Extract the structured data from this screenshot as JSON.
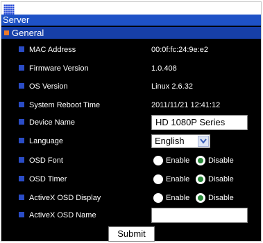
{
  "panel": {
    "title": "Server",
    "section": "General"
  },
  "fields": {
    "mac_address": {
      "label": "MAC Address",
      "value": "00:0f:fc:24:9e:e2"
    },
    "firmware_version": {
      "label": "Firmware Version",
      "value": "1.0.408"
    },
    "os_version": {
      "label": "OS Version",
      "value": "Linux 2.6.32"
    },
    "reboot_time": {
      "label": "System Reboot Time",
      "value": "2011/11/21 12:41:12"
    },
    "device_name": {
      "label": "Device Name",
      "value": "HD 1080P Series"
    },
    "language": {
      "label": "Language",
      "selected": "English"
    },
    "osd_font": {
      "label": "OSD Font",
      "selected": "Disable"
    },
    "osd_timer": {
      "label": "OSD Timer",
      "selected": "Disable"
    },
    "activex_osd_display": {
      "label": "ActiveX OSD Display",
      "selected": "Disable"
    },
    "activex_osd_name": {
      "label": "ActiveX OSD Name",
      "value": ""
    }
  },
  "radio_options": {
    "enable": "Enable",
    "disable": "Disable"
  },
  "submit_label": "Submit",
  "colors": {
    "background": "#000000",
    "title_band": "#1e52c6",
    "section_bar": "#163fa8",
    "section_square": "#f07a2a",
    "bullet": "#2a4cc6",
    "radio_checked": "#2a8a3a"
  }
}
